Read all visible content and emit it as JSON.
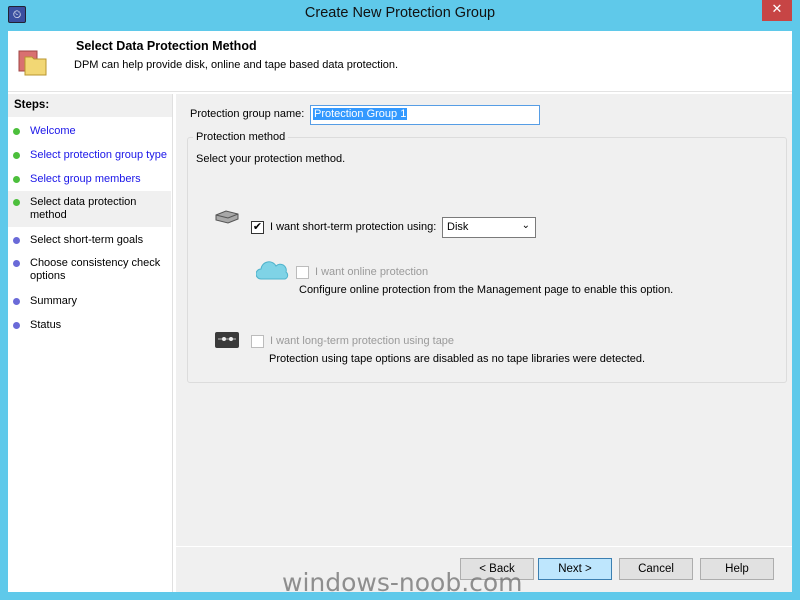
{
  "window": {
    "title": "Create New Protection Group",
    "close_icon": "close-icon",
    "app_icon": "dpm-icon",
    "frame_color": "#5fc9ea"
  },
  "header": {
    "title": "Select Data Protection Method",
    "subtitle": "DPM can help provide disk, online and tape based data protection."
  },
  "steps": {
    "heading": "Steps:",
    "items": [
      {
        "label": "Welcome",
        "state": "done"
      },
      {
        "label": "Select protection group type",
        "state": "done"
      },
      {
        "label": "Select group members",
        "state": "done"
      },
      {
        "label": "Select data protection method",
        "state": "current"
      },
      {
        "label": "Select short-term goals",
        "state": "pending"
      },
      {
        "label": "Choose consistency check options",
        "state": "pending"
      },
      {
        "label": "Summary",
        "state": "pending"
      },
      {
        "label": "Status",
        "state": "pending"
      }
    ]
  },
  "form": {
    "name_label": "Protection group name:",
    "name_value": "Protection Group 1",
    "group_title": "Protection method",
    "instruction": "Select your protection method.",
    "short_term": {
      "label": "I want short-term protection using:",
      "checked": true,
      "select_value": "Disk"
    },
    "online": {
      "label": "I want online protection",
      "checked": false,
      "disabled": true,
      "note": "Configure online protection from the Management page to enable this option."
    },
    "tape": {
      "label": "I want long-term protection using tape",
      "checked": false,
      "disabled": true,
      "note": "Protection using tape options are disabled as no tape libraries were detected."
    }
  },
  "buttons": {
    "back": "< Back",
    "next": "Next >",
    "cancel": "Cancel",
    "help": "Help"
  },
  "watermark": "windows-noob.com"
}
